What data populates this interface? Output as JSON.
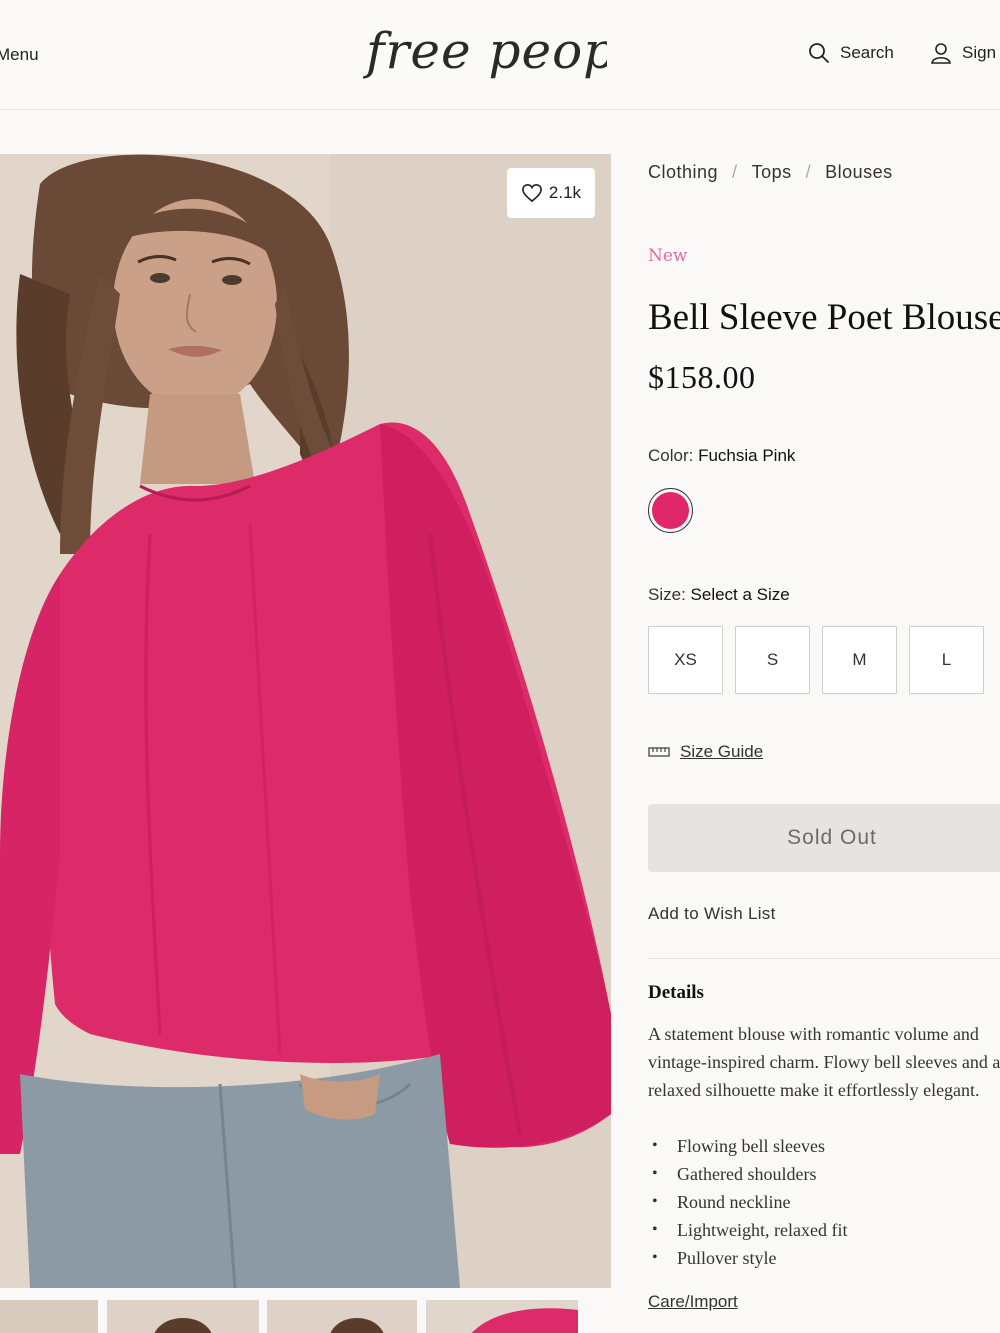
{
  "header": {
    "menu_label": "Menu",
    "logo_text": "free people",
    "search_label": "Search",
    "sign_in_label": "Sign In"
  },
  "product": {
    "likes": "2.1k",
    "breadcrumb": [
      "Clothing",
      "Tops",
      "Blouses"
    ],
    "badge": "New",
    "title": "Bell Sleeve Poet Blouse",
    "price": "$158.00",
    "color_label": "Color:",
    "color_value": "Fuchsia Pink",
    "swatch_color": "#e0276a",
    "size_label": "Size:",
    "size_value": "Select a Size",
    "sizes": [
      "XS",
      "S",
      "M",
      "L"
    ],
    "size_guide": "Size Guide",
    "cta": "Sold Out",
    "wishlist": "Add to Wish List",
    "details_heading": "Details",
    "description_lines": [
      "A statement blouse with romantic volume and",
      "vintage-inspired charm. Flowy bell sleeves and a",
      "relaxed silhouette make it effortlessly elegant."
    ],
    "features": [
      "Flowing bell sleeves",
      "Gathered shoulders",
      "Round neckline",
      "Lightweight, relaxed fit",
      "Pullover style"
    ],
    "care_link": "Care/Import"
  },
  "colors": {
    "accent_pink": "#e26aa6",
    "blouse": "#dd2a69",
    "button_bg": "#e6e4e2"
  }
}
